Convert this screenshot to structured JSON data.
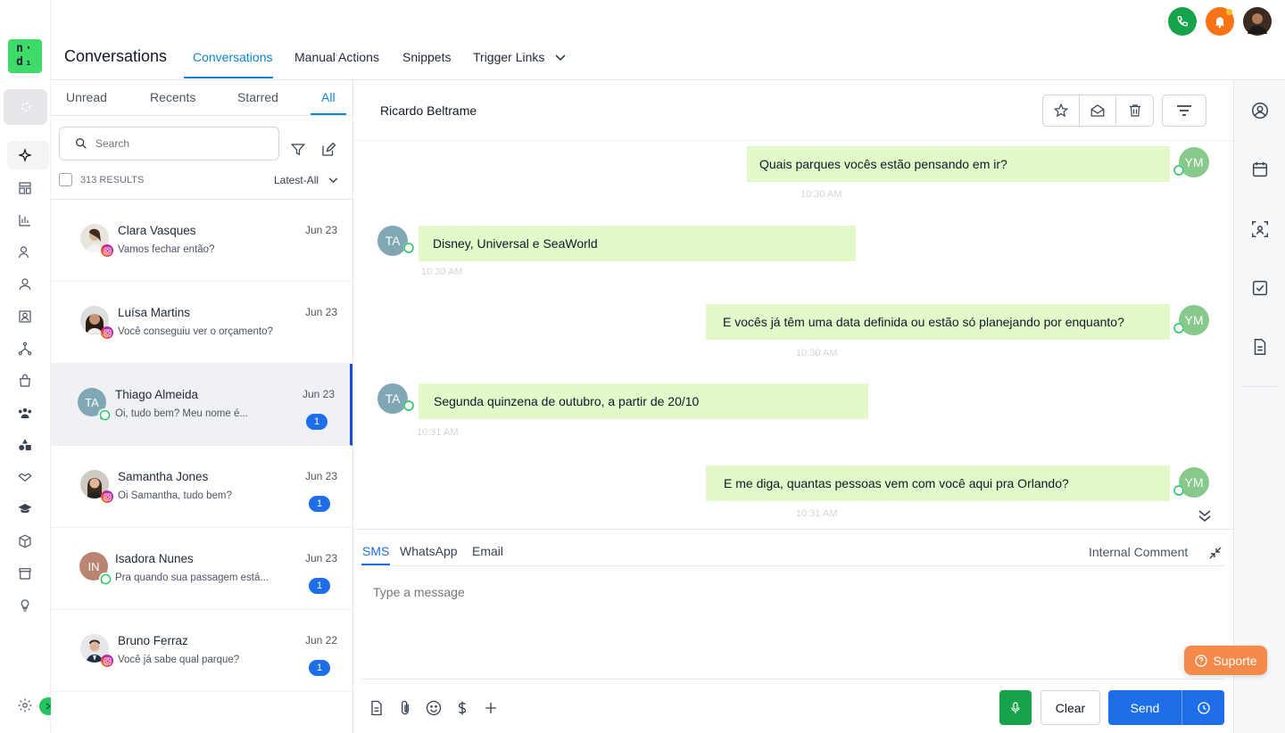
{
  "app": {
    "logo_text": "n·d1"
  },
  "header": {
    "title": "Conversations",
    "tabs": [
      {
        "label": "Conversations",
        "active": true
      },
      {
        "label": "Manual Actions"
      },
      {
        "label": "Snippets"
      },
      {
        "label": "Trigger Links"
      }
    ],
    "notification_color": "#f97316",
    "phone_color": "#16a34a"
  },
  "list": {
    "filter_tabs": [
      "Unread",
      "Recents",
      "Starred",
      "All"
    ],
    "search_placeholder": "Search",
    "results": "313 RESULTS",
    "sort": "Latest-All",
    "conversations": [
      {
        "name": "Clara Vasques",
        "preview": "Vamos fechar então?",
        "date": "Jun 23",
        "channel": "instagram",
        "unread": ""
      },
      {
        "name": "Luísa Martins",
        "preview": "Você conseguiu ver o orçamento?",
        "date": "Jun 23",
        "channel": "instagram",
        "unread": ""
      },
      {
        "name": "Thiago Almeida",
        "initials": "TA",
        "preview": "Oi, tudo bem? Meu nome é...",
        "date": "Jun 23",
        "channel": "whatsapp",
        "unread": "1"
      },
      {
        "name": "Samantha Jones",
        "preview": "Oi Samantha, tudo bem?",
        "date": "Jun 23",
        "channel": "instagram",
        "unread": "1"
      },
      {
        "name": "Isadora Nunes",
        "initials": "IN",
        "preview": "Pra quando sua passagem está...",
        "date": "Jun 23",
        "channel": "whatsapp",
        "unread": "1"
      },
      {
        "name": "Bruno Ferraz",
        "preview": "Você já sabe qual parque?",
        "date": "Jun 22",
        "channel": "instagram",
        "unread": "1"
      }
    ]
  },
  "chat": {
    "contact": "Ricardo Beltrame",
    "messages": [
      {
        "dir": "out",
        "text": "Quais parques vocês estão pensando em ir?",
        "time": "10:30 AM",
        "avatar": "YM"
      },
      {
        "dir": "in",
        "text": "Disney, Universal e SeaWorld",
        "time": "10:30 AM",
        "avatar": "TA"
      },
      {
        "dir": "out",
        "text": "E vocês já têm uma data definida ou estão só planejando por enquanto?",
        "time": "10:30 AM",
        "avatar": "YM"
      },
      {
        "dir": "in",
        "text": "Segunda quinzena de outubro, a partir de 20/10",
        "time": "10:31 AM",
        "avatar": "TA"
      },
      {
        "dir": "out",
        "text": "E me diga, quantas pessoas vem com você aqui pra Orlando?",
        "time": "10:31 AM",
        "avatar": "YM"
      }
    ]
  },
  "composer": {
    "tabs": [
      "SMS",
      "WhatsApp",
      "Email"
    ],
    "internal_comment": "Internal Comment",
    "placeholder": "Type a message",
    "clear": "Clear",
    "send": "Send"
  },
  "support": {
    "label": "Suporte"
  }
}
